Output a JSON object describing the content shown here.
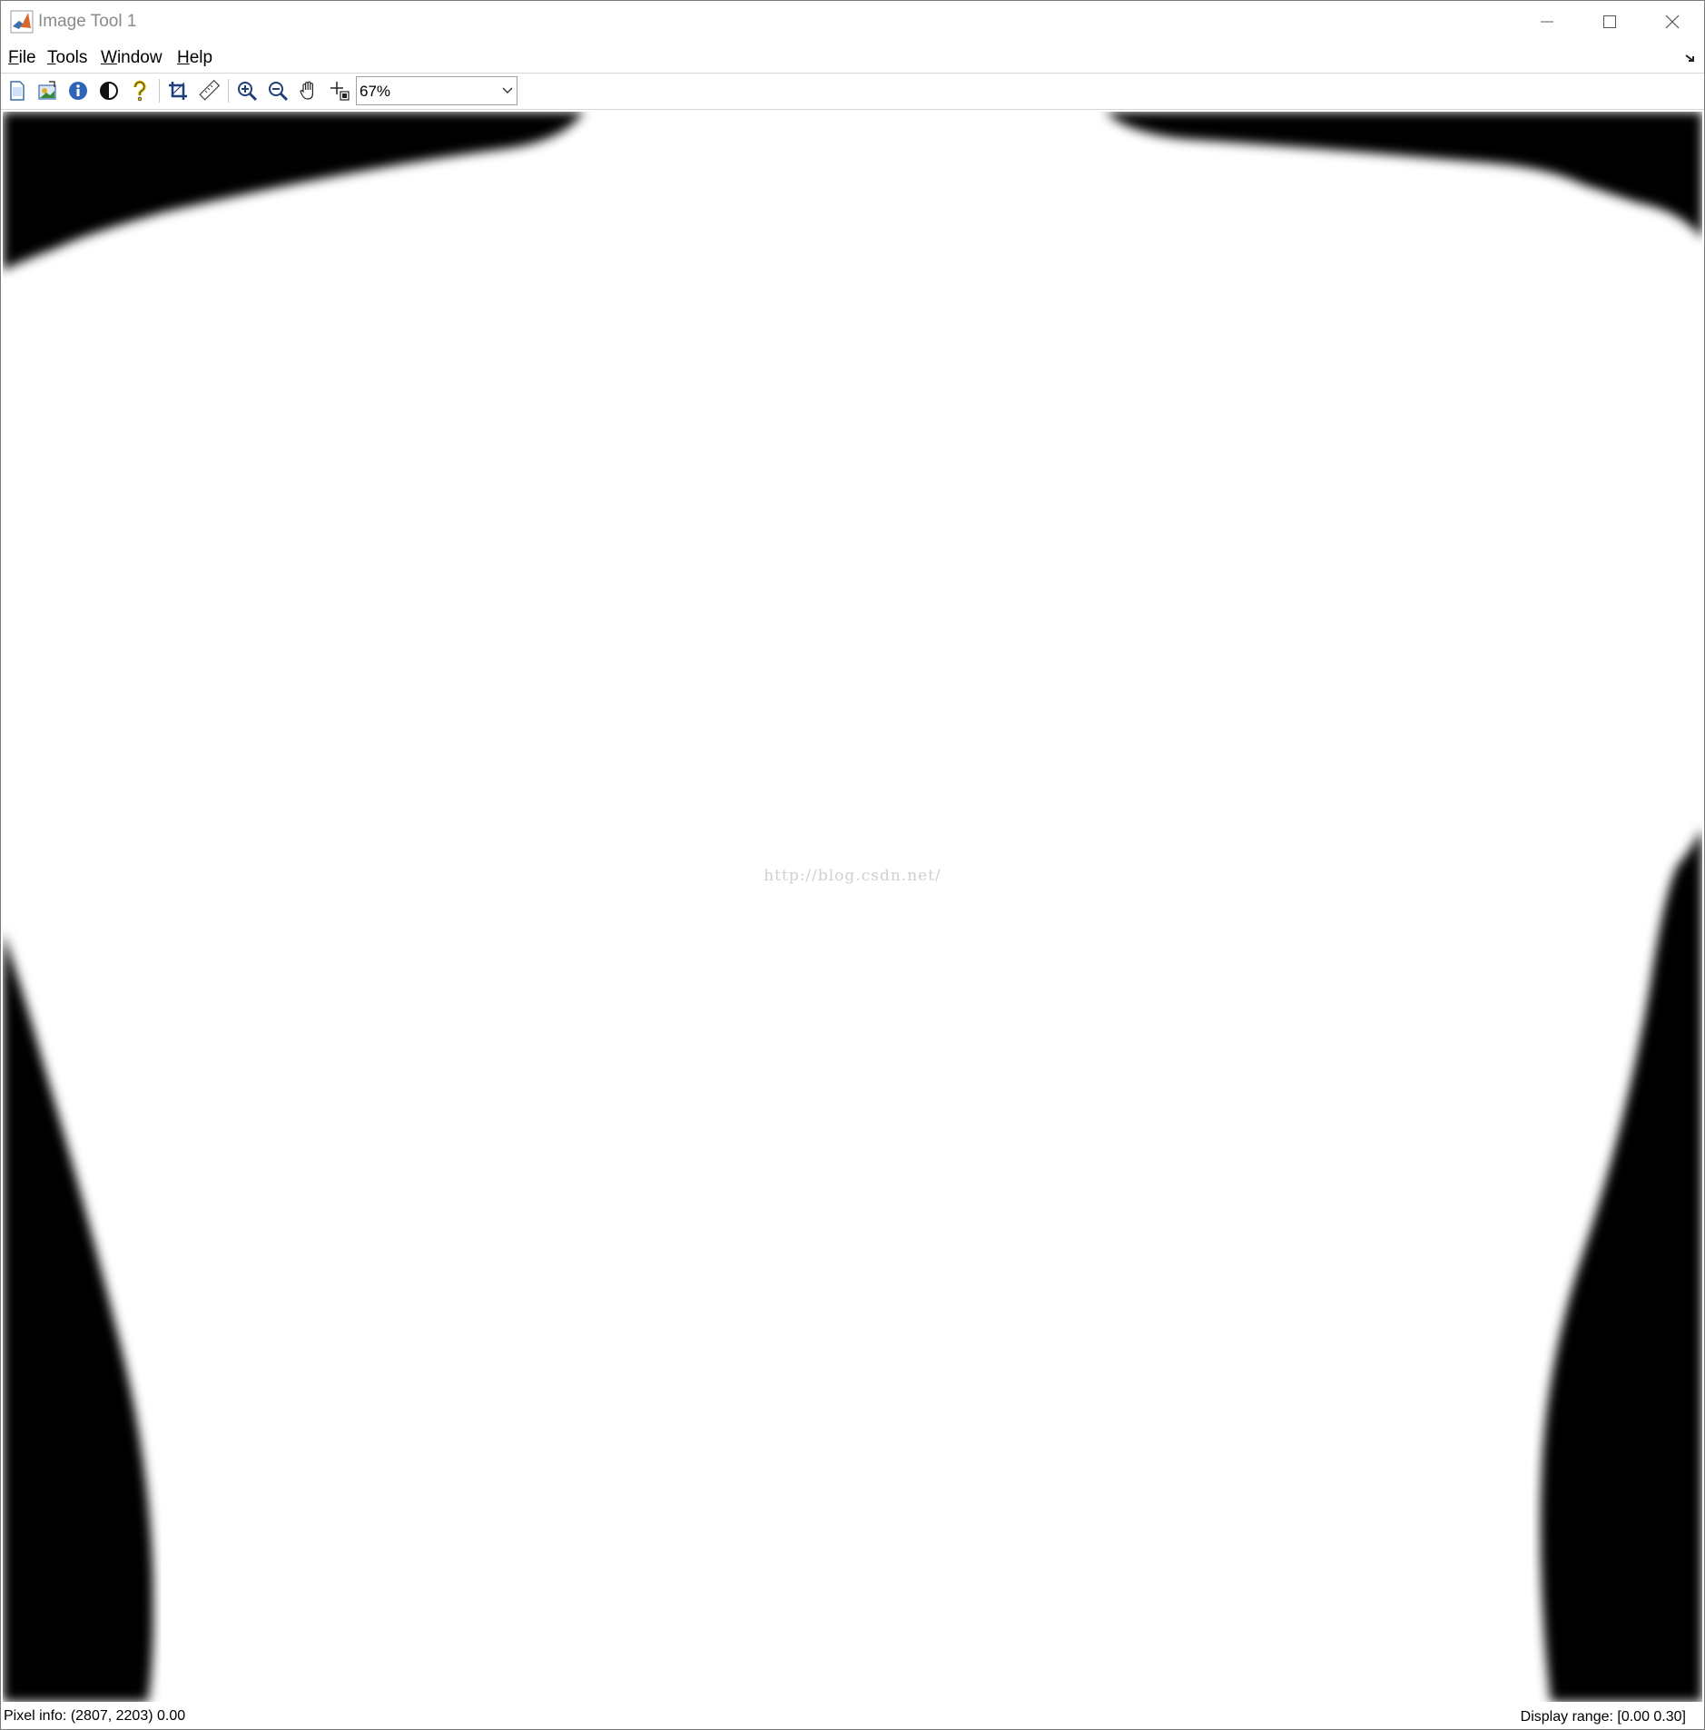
{
  "window": {
    "title": "Image Tool 1",
    "controls": [
      "minimize",
      "maximize",
      "close"
    ]
  },
  "menu": {
    "items": [
      {
        "label": "File",
        "mnemonic": "F"
      },
      {
        "label": "Tools",
        "mnemonic": "T"
      },
      {
        "label": "Window",
        "mnemonic": "W"
      },
      {
        "label": "Help",
        "mnemonic": "H"
      }
    ]
  },
  "toolbar": {
    "buttons": [
      "new-figure-icon",
      "export-image-icon",
      "image-info-icon",
      "contrast-icon",
      "help-icon",
      "crop-icon",
      "distance-tool-icon",
      "zoom-in-icon",
      "zoom-out-icon",
      "pan-hand-icon",
      "pixel-region-icon"
    ],
    "zoom": "67%"
  },
  "image": {
    "watermark": "http://blog.csdn.net/",
    "colors": {
      "foreground": "#ffffff",
      "background": "#000000"
    }
  },
  "status": {
    "pixel_info": "Pixel info: (2807, 2203)  0.00",
    "display_range": "Display range: [0.00 0.30]"
  }
}
